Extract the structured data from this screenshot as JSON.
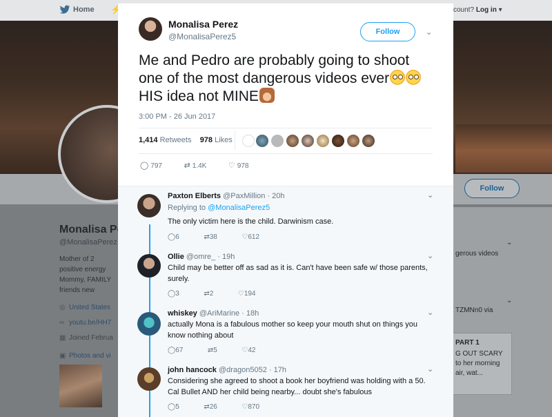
{
  "background": {
    "nav": {
      "home": "Home",
      "login_prefix": "ccount?",
      "login": "Log in"
    },
    "profile": {
      "name": "Monalisa Pe",
      "handle": "@MonalisaPerez",
      "bio_lines": [
        "Mother of 2",
        "positive energy",
        "Mommy, FAMILY",
        "friends",
        "new"
      ],
      "location": "United States",
      "link": "youtu.be/HH7",
      "joined": "Joined Februa",
      "photos": "Photos and vi"
    },
    "follow_button": "Follow",
    "right_panel": {
      "line1": "gerous videos",
      "line2": "TZMNn0 via",
      "card_title": "PART 1",
      "card_line1": "G OUT SCARY",
      "card_line2": "to her morning",
      "card_line3": "air, wat..."
    }
  },
  "tweet": {
    "author_name": "Monalisa Perez",
    "author_handle": "@MonalisaPerez5",
    "follow_label": "Follow",
    "text_line1": "Me and Pedro are probably going to shoot",
    "text_line2": "one of the most dangerous videos ever",
    "text_line3": "HIS idea not MINE",
    "timestamp": "3:00 PM - 26 Jun 2017",
    "retweets_count": "1,414",
    "retweets_label": "Retweets",
    "likes_count": "978",
    "likes_label": "Likes",
    "actions": {
      "replies": "797",
      "retweets": "1.4K",
      "likes": "978"
    }
  },
  "replies": [
    {
      "name": "Paxton Elberts",
      "handle": "@PaxMillion",
      "time": "20h",
      "replying_prefix": "Replying to",
      "replying_to": "@MonalisaPerez5",
      "text": "The only victim here is the child. Darwinism case.",
      "replies": "6",
      "retweets": "38",
      "likes": "612"
    },
    {
      "name": "Ollie",
      "handle": "@omre_",
      "time": "19h",
      "text": "Child may be better off as sad as it is. Can't have been safe w/ those parents, surely.",
      "replies": "3",
      "retweets": "2",
      "likes": "194"
    },
    {
      "name": "whiskey",
      "handle": "@AriMarine",
      "time": "18h",
      "text": "actually Mona is a fabulous mother so keep your mouth shut on things you know nothing about",
      "replies": "67",
      "retweets": "5",
      "likes": "42"
    },
    {
      "name": "john hancock",
      "handle": "@dragon5052",
      "time": "17h",
      "text": "Considering she agreed to shoot a book her boyfriend was holding with a 50. Cal Bullet AND her child being nearby... doubt she's fabulous",
      "replies": "5",
      "retweets": "26",
      "likes": "870"
    }
  ],
  "colors": {
    "accent": "#1da1f2",
    "muted": "#657786",
    "text": "#14171a"
  }
}
